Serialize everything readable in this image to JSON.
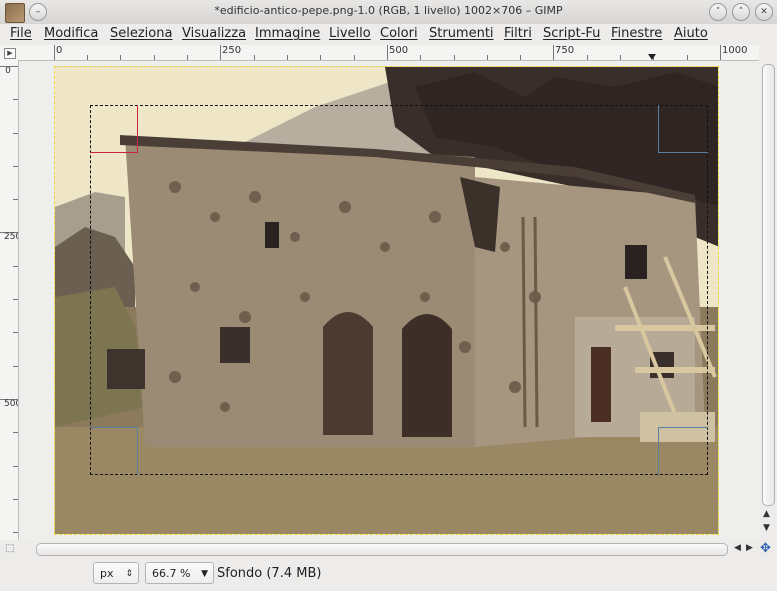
{
  "window": {
    "title": "*edificio-antico-pepe.png-1.0 (RGB, 1 livello) 1002×706 – GIMP",
    "minimize_glyph": "˅",
    "maximize_glyph": "˄",
    "close_glyph": "✕",
    "menu_glyph": "–"
  },
  "menu": [
    {
      "label": "File"
    },
    {
      "label": "Modifica"
    },
    {
      "label": "Seleziona"
    },
    {
      "label": "Visualizza"
    },
    {
      "label": "Immagine"
    },
    {
      "label": "Livello"
    },
    {
      "label": "Colori"
    },
    {
      "label": "Strumenti"
    },
    {
      "label": "Filtri"
    },
    {
      "label": "Script-Fu"
    },
    {
      "label": "Finestre"
    },
    {
      "label": "Aiuto"
    }
  ],
  "ruler_top": {
    "labels": [
      "0",
      "250",
      "500",
      "750",
      "1000"
    ]
  },
  "ruler_left": {
    "labels": [
      "0",
      "250",
      "500"
    ]
  },
  "statusbar": {
    "unit": "px",
    "zoom": "66.7 %",
    "layer_info": "Sfondo (7.4 MB)"
  },
  "colors": {
    "image_border": "#f0d840",
    "selection": "#000000"
  },
  "icons": {
    "navigate": "move-arrows-icon",
    "quick_mask": "quick-mask-icon",
    "menu_arrow": "triangle-right-icon"
  }
}
